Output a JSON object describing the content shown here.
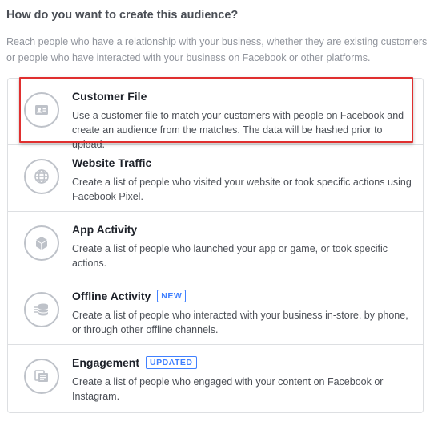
{
  "heading": "How do you want to create this audience?",
  "subtext": "Reach people who have a relationship with your business, whether they are existing customers or people who have interacted with your business on Facebook or other platforms.",
  "options": [
    {
      "title": "Customer File",
      "badge": "",
      "description": "Use a customer file to match your customers with people on Facebook and create an audience from the matches. The data will be hashed prior to upload.",
      "icon": "contact-card-icon"
    },
    {
      "title": "Website Traffic",
      "badge": "",
      "description": "Create a list of people who visited your website or took specific actions using Facebook Pixel.",
      "icon": "globe-icon"
    },
    {
      "title": "App Activity",
      "badge": "",
      "description": "Create a list of people who launched your app or game, or took specific actions.",
      "icon": "cube-icon"
    },
    {
      "title": "Offline Activity",
      "badge": "NEW",
      "description": "Create a list of people who interacted with your business in-store, by phone, or through other offline channels.",
      "icon": "offline-data-icon"
    },
    {
      "title": "Engagement",
      "badge": "UPDATED",
      "description": "Create a list of people who engaged with your content on Facebook or Instagram.",
      "icon": "engagement-cards-icon"
    }
  ],
  "colors": {
    "highlight": "#e02f2f",
    "badge": "#4080ff",
    "icon_stroke": "#bec2c9",
    "border": "#dddfe2"
  }
}
